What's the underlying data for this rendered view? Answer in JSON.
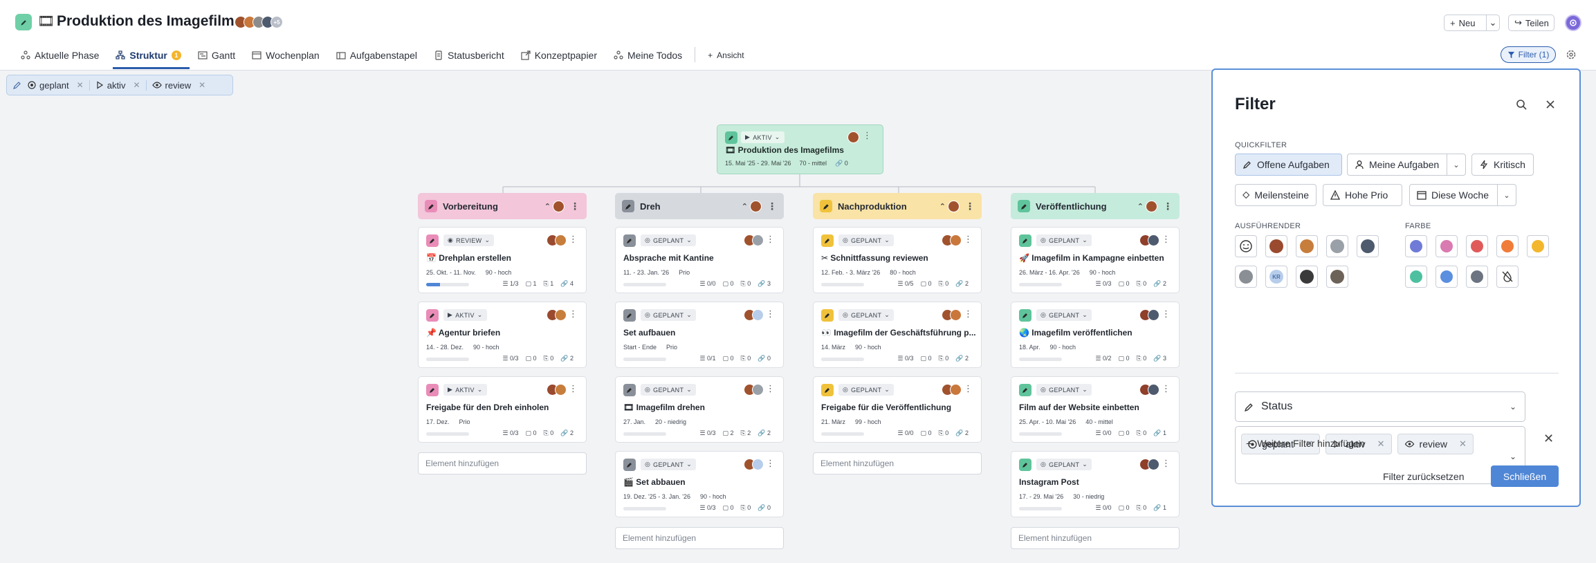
{
  "header": {
    "title_emoji": "🎞",
    "title": "Produktion des Imagefilms",
    "avatar_more": "+5",
    "new_label": "Neu",
    "share_label": "Teilen"
  },
  "tabs": [
    {
      "label": "Aktuelle Phase"
    },
    {
      "label": "Struktur",
      "badge": "1"
    },
    {
      "label": "Gantt"
    },
    {
      "label": "Wochenplan"
    },
    {
      "label": "Aufgabenstapel"
    },
    {
      "label": "Statusbericht"
    },
    {
      "label": "Konzeptpapier"
    },
    {
      "label": "Meine Todos"
    },
    {
      "label": "Ansicht"
    }
  ],
  "filter_button": {
    "label": "Filter (1)"
  },
  "active_filters": [
    {
      "label": "geplant"
    },
    {
      "label": "aktiv"
    },
    {
      "label": "review"
    }
  ],
  "root": {
    "status": "AKTIV",
    "title": "🎞 Produktion des Imagefilms",
    "dates": "15. Mai '25 - 29. Mai '26",
    "priority": "70 - mittel",
    "links": "0"
  },
  "columns": [
    {
      "title": "Vorbereitung",
      "color": "#f3c6da",
      "icon_color": "#e98cb8",
      "cards": [
        {
          "status": "REVIEW",
          "title": "📅 Drehplan erstellen",
          "dates": "25. Okt. - 11. Nov.",
          "prio": "90 - hoch",
          "progress": 0.33,
          "subtasks": "1/3",
          "comments": "1",
          "files": "1",
          "links": "4"
        },
        {
          "status": "AKTIV",
          "title": "📌 Agentur briefen",
          "dates": "14. - 28. Dez.",
          "prio": "90 - hoch",
          "progress": 0,
          "subtasks": "0/3",
          "comments": "0",
          "files": "0",
          "links": "2"
        },
        {
          "status": "AKTIV",
          "title": "Freigabe für den Dreh einholen",
          "dates": "17. Dez.",
          "prio": "Prio",
          "progress": 0,
          "subtasks": "0/3",
          "comments": "0",
          "files": "0",
          "links": "2"
        }
      ],
      "add_label": "Element hinzufügen"
    },
    {
      "title": "Dreh",
      "color": "#d6d9de",
      "icon_color": "#8a9099",
      "cards": [
        {
          "status": "GEPLANT",
          "title": "Absprache mit Kantine",
          "dates": "11. - 23. Jan. '26",
          "prio": "Prio",
          "progress": 0,
          "subtasks": "0/0",
          "comments": "0",
          "files": "0",
          "links": "3"
        },
        {
          "status": "GEPLANT",
          "title": "Set aufbauen",
          "dates": "Start - Ende",
          "prio": "Prio",
          "progress": 0,
          "subtasks": "0/1",
          "comments": "0",
          "files": "0",
          "links": "0"
        },
        {
          "status": "GEPLANT",
          "title": "🎞 Imagefilm drehen",
          "dates": "27. Jan.",
          "prio": "20 - niedrig",
          "progress": 0,
          "subtasks": "0/3",
          "comments": "2",
          "files": "2",
          "links": "2"
        },
        {
          "status": "GEPLANT",
          "title": "🎬 Set abbauen",
          "dates": "19. Dez. '25 - 3. Jan. '26",
          "prio": "90 - hoch",
          "progress": 0,
          "subtasks": "0/3",
          "comments": "0",
          "files": "0",
          "links": "0"
        }
      ],
      "add_label": "Element hinzufügen"
    },
    {
      "title": "Nachproduktion",
      "color": "#f9e3a6",
      "icon_color": "#f0c23c",
      "cards": [
        {
          "status": "GEPLANT",
          "title": "✂ Schnittfassung reviewen",
          "dates": "12. Feb. - 3. März '26",
          "prio": "80 - hoch",
          "progress": 0,
          "subtasks": "0/5",
          "comments": "0",
          "files": "0",
          "links": "2"
        },
        {
          "status": "GEPLANT",
          "title": "👀 Imagefilm der Geschäftsführung p...",
          "dates": "14. März",
          "prio": "90 - hoch",
          "progress": 0,
          "subtasks": "0/3",
          "comments": "0",
          "files": "0",
          "links": "2"
        },
        {
          "status": "GEPLANT",
          "title": "Freigabe für die Veröffentlichung",
          "dates": "21. März",
          "prio": "99 - hoch",
          "progress": 0,
          "subtasks": "0/0",
          "comments": "0",
          "files": "0",
          "links": "2"
        }
      ],
      "add_label": "Element hinzufügen"
    },
    {
      "title": "Veröffentlichung",
      "color": "#c5ebdc",
      "icon_color": "#5fc49b",
      "cards": [
        {
          "status": "GEPLANT",
          "title": "🚀 Imagefilm in Kampagne einbetten",
          "dates": "26. März - 16. Apr. '26",
          "prio": "90 - hoch",
          "progress": 0,
          "subtasks": "0/3",
          "comments": "0",
          "files": "0",
          "links": "2"
        },
        {
          "status": "GEPLANT",
          "title": "🌏 Imagefilm veröffentlichen",
          "dates": "18. Apr.",
          "prio": "90 - hoch",
          "progress": 0,
          "subtasks": "0/2",
          "comments": "0",
          "files": "0",
          "links": "3"
        },
        {
          "status": "GEPLANT",
          "title": "Film auf der Website einbetten",
          "dates": "25. Apr. - 10. Mai '26",
          "prio": "40 - mittel",
          "progress": 0,
          "subtasks": "0/0",
          "comments": "0",
          "files": "0",
          "links": "1"
        },
        {
          "status": "GEPLANT",
          "title": "Instagram Post",
          "dates": "17. - 29. Mai '26",
          "prio": "30 - niedrig",
          "progress": 0,
          "subtasks": "0/0",
          "comments": "0",
          "files": "0",
          "links": "1"
        }
      ],
      "add_label": "Element hinzufügen"
    }
  ],
  "filter_panel": {
    "title": "Filter",
    "quickfilter_label": "QUICKFILTER",
    "quickfilters": [
      "Offene Aufgaben",
      "Meine Aufgaben",
      "Kritisch",
      "Meilensteine",
      "Hohe Prio",
      "Diese Woche"
    ],
    "assignee_label": "AUSFÜHRENDER",
    "assignee_initials": "KR",
    "color_label": "FARBE",
    "colors": [
      "#6f7bd6",
      "#d97ab0",
      "#e05a5a",
      "#f07c3a",
      "#f2b72e",
      "#4ec0a0",
      "#5b8fdf",
      "#6b7480"
    ],
    "status_field_label": "Status",
    "status_values": [
      "geplant",
      "aktiv",
      "review"
    ],
    "more_filters_label": "Weitere Filter hinzufügen",
    "reset_label": "Filter zurücksetzen",
    "close_label": "Schließen"
  }
}
